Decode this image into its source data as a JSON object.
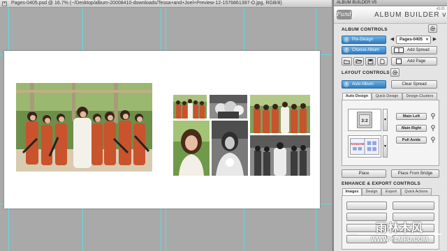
{
  "document": {
    "title": "Pages-0405.psd @ 16.7% (~/Desktop/album-20008410-downloads/Tessa+and+Joel+Preview-12-1576861397-O.jpg, RGB/8)",
    "close_glyph": "×"
  },
  "panel": {
    "window_title": "ALBUM BUILDER V5",
    "brand": "Fundy",
    "app_title": "ALBUM BUILDER v5",
    "version": "v5.01",
    "album_controls": {
      "label": "ALBUM CONTROLS",
      "pre_design": {
        "num": "1",
        "label": "Pre-Design"
      },
      "choose_album": {
        "num": "2",
        "label": "Choose Album"
      },
      "page_select": "Pages-0405",
      "prev_glyph": "◀",
      "next_glyph": "▶",
      "dropdown_glyph": "▼",
      "add_spread": "Add Spread",
      "add_page": "Add Page"
    },
    "layout_controls": {
      "label": "LAYOUT CONTROLS",
      "auto_album": {
        "num": "3",
        "label": "Auto Album"
      },
      "clear_spread": "Clear Spread",
      "tabs": [
        "Auto Design",
        "Quick Design",
        "Design Clusters"
      ],
      "ratio_label": "3:2",
      "random_label": "RANDOM",
      "main_left": "Main Left",
      "main_right": "Main Right",
      "pull_aside": "Pull Aside",
      "place": "Place",
      "place_from_bridge": "Place From Bridge"
    },
    "enhance_export": {
      "label": "ENHANCE & EXPORT CONTROLS",
      "tabs": [
        "Images",
        "Design",
        "Export",
        "Quick Actions"
      ]
    }
  },
  "watermark": {
    "title": "雨林木风",
    "url": "WWW.YLMFU.COM"
  },
  "colors": {
    "accent_blue": "#2f7cc0",
    "guide_cyan": "#4fe3ee",
    "dress_orange": "#c8532c"
  }
}
